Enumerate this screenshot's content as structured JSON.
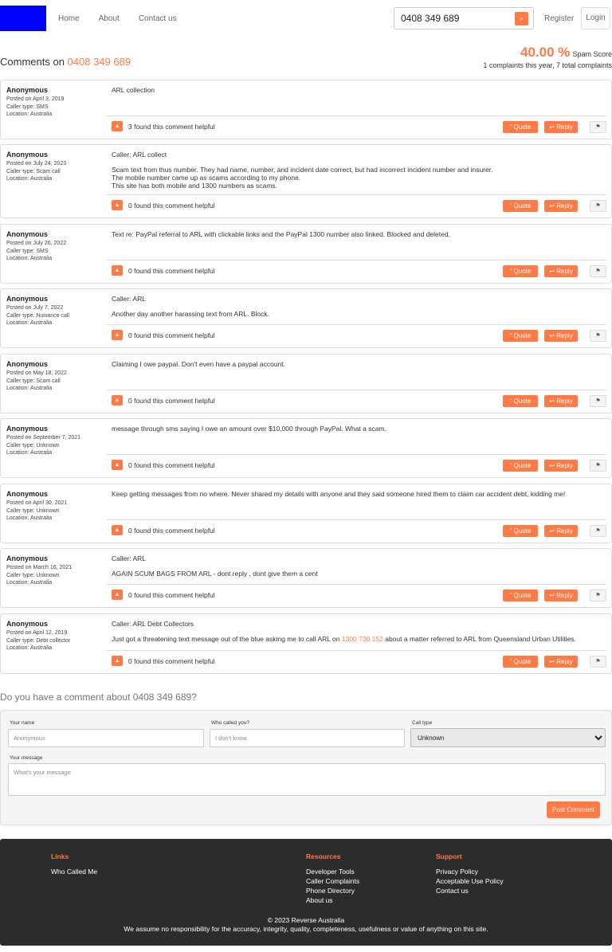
{
  "header": {
    "nav": [
      "Home",
      "About",
      "Contact us"
    ],
    "search_value": "0408 349 689",
    "register": "Register",
    "login": "Login"
  },
  "title": {
    "prefix": "Comments on ",
    "number": "0408 349 689"
  },
  "spam": {
    "percent": "40.00 %",
    "label": "Spam Score",
    "summary": "1 complaints this year, 7 total complaints"
  },
  "comments": [
    {
      "author": "Anonymous",
      "posted": "Posted on April 3, 2019",
      "caller_type": "Caller type: SMS",
      "location": "Location: Australia",
      "lines": [
        "ARL collection"
      ],
      "helpful": "3 found this comment helpful"
    },
    {
      "author": "Anonymous",
      "posted": "Posted on July 24, 2023",
      "caller_type": "Caller type: Scam call",
      "location": "Location: Australia",
      "lines": [
        "Caller: ARL collect",
        "",
        "Scam text from thus number. They had name, number, and incident date correct, but had incorrect incident number and insurer.",
        "The mobile number came up as scams according to my phone.",
        "This site has both mobile and 1300 numbers as scams."
      ],
      "helpful": "0 found this comment helpful"
    },
    {
      "author": "Anonymous",
      "posted": "Posted on July 26, 2022",
      "caller_type": "Caller type: SMS",
      "location": "Location: Australia",
      "lines": [
        "Text re: PayPal referral to ARL with clickable links and the PayPal 1300 number also linked. Blocked and deleted."
      ],
      "helpful": "0 found this comment helpful"
    },
    {
      "author": "Anonymous",
      "posted": "Posted on July 7, 2022",
      "caller_type": "Caller type: Nuisance call",
      "location": "Location: Australia",
      "lines": [
        "Caller: ARL",
        "",
        "Another day another harassing text from ARL. Block."
      ],
      "helpful": "0 found this comment helpful"
    },
    {
      "author": "Anonymous",
      "posted": "Posted on May 18, 2022",
      "caller_type": "Caller type: Scam call",
      "location": "Location: Australia",
      "lines": [
        "Claiming I owe paypal. Don't even have a paypal account."
      ],
      "helpful": "0 found this comment helpful"
    },
    {
      "author": "Anonymous",
      "posted": "Posted on September 7, 2021",
      "caller_type": "Caller type: Unknown",
      "location": "Location: Australia",
      "lines": [
        "message through sms saying I owe an amount over $10,000 through PayPal. What a scam."
      ],
      "helpful": "0 found this comment helpful"
    },
    {
      "author": "Anonymous",
      "posted": "Posted on April 30, 2021",
      "caller_type": "Caller type: Unknown",
      "location": "Location: Australia",
      "lines": [
        "Keep getting messages from no where. Never shared my details with anyone and they said someone hired them to claim car accident debt, kidding me!"
      ],
      "helpful": "0 found this comment helpful"
    },
    {
      "author": "Anonymous",
      "posted": "Posted on March 16, 2021",
      "caller_type": "Caller type: Unknown",
      "location": "Location: Australia",
      "lines": [
        "Caller: ARL",
        "",
        "AGAIN SCUM BAGS FROM ARL - dont reply , dont give them a cent"
      ],
      "helpful": "0 found this comment helpful"
    },
    {
      "author": "Anonymous",
      "posted": "Posted on April 12, 2019",
      "caller_type": "Caller type: Debt collector",
      "location": "Location: Australia",
      "lines": [
        "Caller: ARL Debt Collectors",
        ""
      ],
      "last_line": {
        "before": "Just got a threatening text message out of the blue asking me to call ARL on ",
        "link": "1300 730 152",
        "after": " about a matter referred to ARL from Queensland Urban Utilities."
      },
      "helpful": "0 found this comment helpful"
    }
  ],
  "buttons": {
    "quote": "Quote",
    "reply": "Reply"
  },
  "form": {
    "title": "Do you have a comment about 0408 349 689?",
    "name_label": "Your name",
    "name_placeholder": "Anonymous",
    "who_label": "Who called you?",
    "who_placeholder": "I don't know",
    "type_label": "Call type",
    "type_value": "Unknown",
    "message_label": "Your message",
    "message_placeholder": "What's your message",
    "submit": "Post Comment"
  },
  "footer": {
    "links_title": "Links",
    "links": [
      "Who Called Me"
    ],
    "resources_title": "Resources",
    "resources": [
      "Developer Tools",
      "Caller Complaints",
      "Phone Directory",
      "About us"
    ],
    "support_title": "Support",
    "support": [
      "Privacy Policy",
      "Acceptable Use Policy",
      "Contact us"
    ],
    "copyright": "© 2023 Reverse Australia",
    "disclaimer": "We assume no responsibility for the accuracy, integrity, quality, completeness, usefulness or value of anything on this site."
  },
  "colors": {
    "accent": "#ff7a45",
    "logo": "#0000ff",
    "footer_bg": "#2c2c2c"
  }
}
